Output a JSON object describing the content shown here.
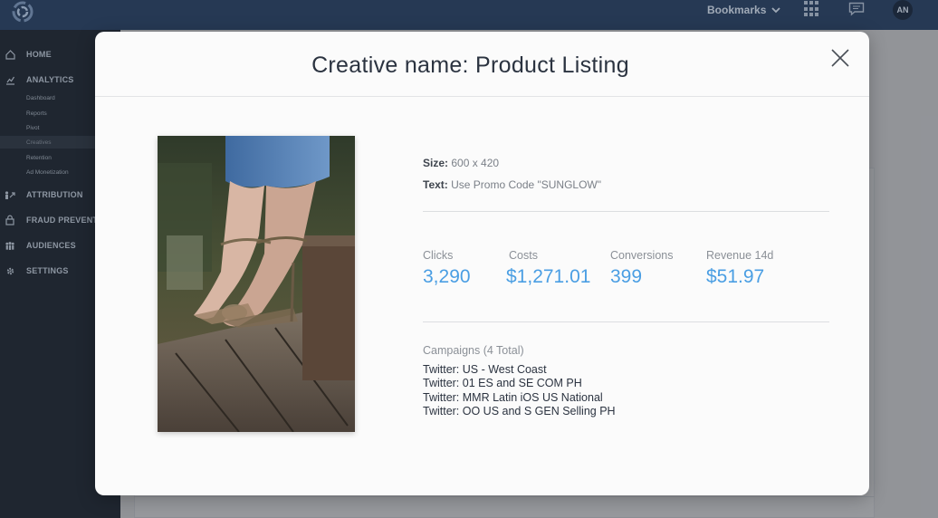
{
  "topbar": {
    "bookmarks_label": "Bookmarks",
    "user_initials": "AN"
  },
  "sidebar": {
    "items": [
      {
        "label": "HOME",
        "icon": "home-icon"
      },
      {
        "label": "ANALYTICS",
        "icon": "analytics-icon"
      },
      {
        "label": "ATTRIBUTION",
        "icon": "attribution-icon"
      },
      {
        "label": "FRAUD PREVENTI",
        "icon": "lock-icon"
      },
      {
        "label": "AUDIENCES",
        "icon": "audiences-icon"
      },
      {
        "label": "SETTINGS",
        "icon": "gear-icon"
      }
    ],
    "analytics_sub": [
      "Dashboard",
      "Reports",
      "Pivot",
      "Creatives",
      "Retention",
      "Ad Monetization"
    ],
    "active_sub": "Creatives"
  },
  "modal": {
    "title": "Creative name: Product Listing",
    "size_label": "Size:",
    "size_value": "600 x 420",
    "text_label": "Text:",
    "text_value": "Use Promo Code \"SUNGLOW\"",
    "image_alt": "creative-image",
    "stats": [
      {
        "label": "Clicks",
        "value": "3,290"
      },
      {
        "label": "Costs",
        "value": "$1,271.01"
      },
      {
        "label": "Conversions",
        "value": "399"
      },
      {
        "label": "Revenue 14d",
        "value": "$51.97"
      }
    ],
    "campaigns_header": "Campaigns (4 Total)",
    "campaigns": [
      "Twitter: US - West Coast",
      "Twitter: 01 ES  and SE COM PH",
      "Twitter: MMR Latin iOS US National",
      "Twitter: OO US  and S GEN Selling PH"
    ]
  },
  "colors": {
    "accent": "#4a9ee3",
    "topbar": "#2a3f5c",
    "sidebar": "#1f2630"
  }
}
